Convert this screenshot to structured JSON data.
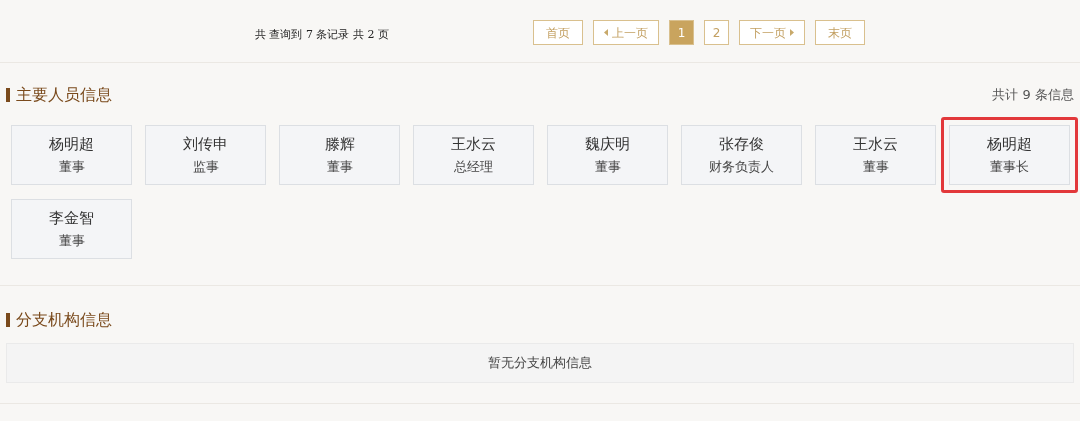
{
  "pagination": {
    "summary": "共 查询到 7 条记录 共 2 页",
    "buttons": [
      {
        "kind": "text",
        "label": "首页",
        "selected": false
      },
      {
        "kind": "prev",
        "label": "上一页",
        "selected": false
      },
      {
        "kind": "page",
        "label": "1",
        "selected": true
      },
      {
        "kind": "page",
        "label": "2",
        "selected": false
      },
      {
        "kind": "next",
        "label": "下一页",
        "selected": false
      },
      {
        "kind": "text",
        "label": "末页",
        "selected": false
      }
    ]
  },
  "key_personnel": {
    "title": "主要人员信息",
    "count": "共计 9 条信息",
    "people": [
      {
        "name": "杨明超",
        "role": "董事",
        "highlighted": false
      },
      {
        "name": "刘传申",
        "role": "监事",
        "highlighted": false
      },
      {
        "name": "滕辉",
        "role": "董事",
        "highlighted": false
      },
      {
        "name": "王水云",
        "role": "总经理",
        "highlighted": false
      },
      {
        "name": "魏庆明",
        "role": "董事",
        "highlighted": false
      },
      {
        "name": "张存俊",
        "role": "财务负责人",
        "highlighted": false
      },
      {
        "name": "王水云",
        "role": "董事",
        "highlighted": false
      },
      {
        "name": "杨明超",
        "role": "董事长",
        "highlighted": true
      },
      {
        "name": "李金智",
        "role": "董事",
        "highlighted": false
      }
    ]
  },
  "branches": {
    "title": "分支机构信息",
    "empty_text": "暂无分支机构信息"
  }
}
